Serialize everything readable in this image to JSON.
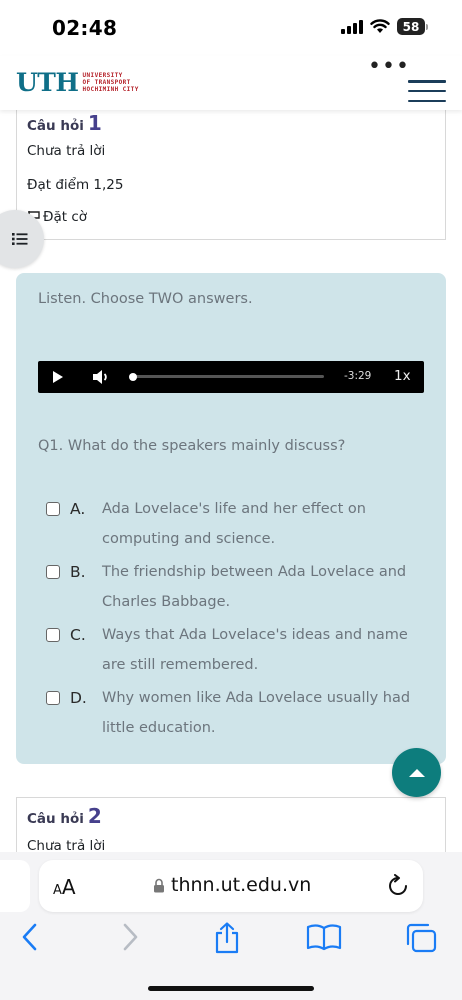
{
  "status_bar": {
    "time": "02:48",
    "battery": "58"
  },
  "header": {
    "logo_mark": "UTH",
    "logo_line1": "UNIVERSITY",
    "logo_line2": "OF TRANSPORT",
    "logo_line3": "HOCHIMINH CITY",
    "more_icon": "ellipsis-icon",
    "menu_icon": "hamburger-menu-icon"
  },
  "question_info": {
    "label": "Câu hỏi",
    "number": "1",
    "status": "Chưa trả lời",
    "points": "Đạt điểm 1,25",
    "flag_label": "Đặt cờ"
  },
  "question": {
    "instruction": "Listen. Choose TWO answers.",
    "audio": {
      "time_remaining": "-3:29",
      "speed": "1x",
      "progress": 0.0
    },
    "text": "Q1. What do the speakers mainly discuss?",
    "options": [
      {
        "letter": "A.",
        "lines": [
          "Ada Lovelace's life and her effect on",
          "computing and science."
        ],
        "checked": false
      },
      {
        "letter": "B.",
        "lines": [
          "The friendship between Ada Lovelace and",
          "Charles Babbage."
        ],
        "checked": false
      },
      {
        "letter": "C.",
        "lines": [
          "Ways that Ada Lovelace's ideas and name",
          "are still remembered."
        ],
        "checked": false
      },
      {
        "letter": "D.",
        "lines": [
          "Why women like Ada Lovelace usually had",
          "little education."
        ],
        "checked": false
      }
    ]
  },
  "question2": {
    "label": "Câu hỏi",
    "number": "2",
    "status": "Chưa trả lời"
  },
  "browser": {
    "aa_small": "A",
    "aa_big": "A",
    "url": "thnn.ut.edu.vn",
    "toolbar_icons": [
      "back-icon",
      "forward-icon",
      "share-icon",
      "bookmarks-icon",
      "tabs-icon"
    ]
  },
  "colors": {
    "content_bg": "#cfe4e9",
    "scroll_top_bg": "#0d7d7d",
    "logo_blue": "#0f6f88",
    "logo_red": "#b5232b",
    "question_number": "#46408c",
    "safari_blue": "#1a7cf5"
  }
}
